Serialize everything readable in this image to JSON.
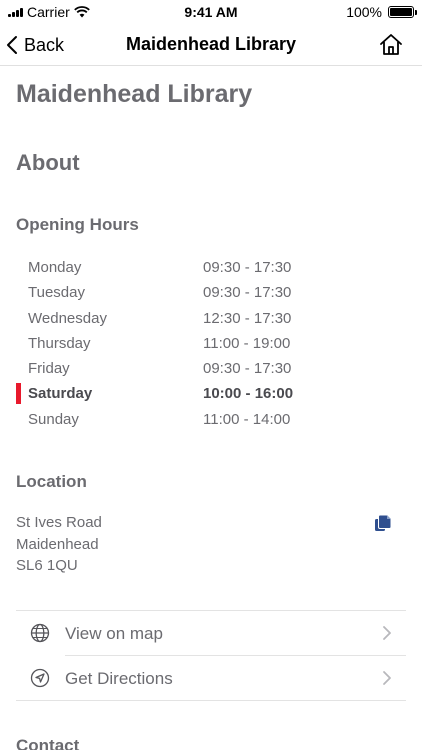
{
  "status_bar": {
    "carrier": "Carrier",
    "time": "9:41 AM",
    "battery": "100%",
    "battery_level": 1.0
  },
  "nav": {
    "back_label": "Back",
    "title": "Maidenhead Library"
  },
  "page": {
    "title": "Maidenhead Library",
    "about_heading": "About",
    "opening_hours_heading": "Opening Hours",
    "opening_hours": [
      {
        "day": "Monday",
        "time": "09:30 - 17:30"
      },
      {
        "day": "Tuesday",
        "time": "09:30 - 17:30"
      },
      {
        "day": "Wednesday",
        "time": "12:30 - 17:30"
      },
      {
        "day": "Thursday",
        "time": "11:00 - 19:00"
      },
      {
        "day": "Friday",
        "time": "09:30 - 17:30"
      },
      {
        "day": "Saturday",
        "time": "10:00 - 16:00"
      },
      {
        "day": "Sunday",
        "time": "11:00 - 14:00"
      }
    ],
    "today_index": 5,
    "location_heading": "Location",
    "address": [
      "St Ives Road",
      "Maidenhead",
      "SL6 1QU"
    ],
    "links": [
      {
        "label": "View on map",
        "icon": "globe-icon"
      },
      {
        "label": "Get Directions",
        "icon": "navigation-arrow-icon"
      }
    ],
    "contact_heading": "Contact"
  },
  "colors": {
    "today_marker": "#e8192c",
    "copy_icon": "#2f4f8f"
  }
}
